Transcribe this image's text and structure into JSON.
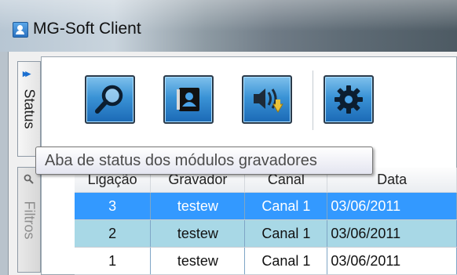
{
  "window": {
    "title": "MG-Soft Client"
  },
  "tabs": [
    {
      "label": "Status",
      "active": true,
      "icon": "double-chevron-right-icon"
    },
    {
      "label": "Filtros",
      "active": false,
      "icon": "search-icon"
    }
  ],
  "toolbar": {
    "buttons": [
      {
        "icon": "search-icon"
      },
      {
        "icon": "address-book-icon"
      },
      {
        "icon": "speaker-download-icon"
      },
      {
        "icon": "gear-icon"
      }
    ]
  },
  "tooltip": {
    "text": "Aba de status dos módulos gravadores"
  },
  "grid": {
    "columns": [
      "Ligação",
      "Gravador",
      "Canal",
      "Data"
    ],
    "rows": [
      {
        "ligacao": "3",
        "gravador": "testew",
        "canal": "Canal 1",
        "data": "03/06/2011",
        "selected": true
      },
      {
        "ligacao": "2",
        "gravador": "testew",
        "canal": "Canal 1",
        "data": "03/06/2011",
        "selected": false
      },
      {
        "ligacao": "1",
        "gravador": "testew",
        "canal": "Canal 1",
        "data": "03/06/2011",
        "selected": false
      }
    ]
  },
  "colors": {
    "accent": "#3399ff",
    "row_alt": "#a8d8e6",
    "button": "#3a93d6"
  }
}
